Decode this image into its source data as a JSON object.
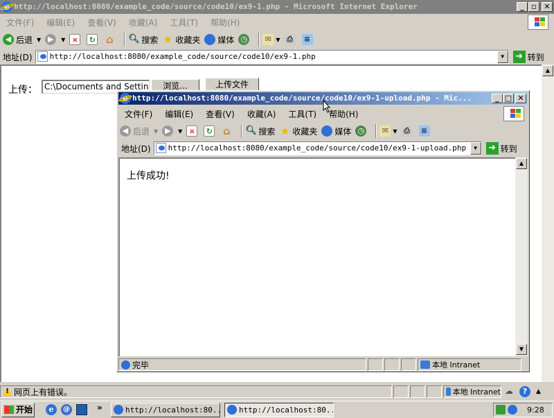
{
  "outer": {
    "title": "http://localhost:8080/example_code/source/code10/ex9-1.php - Microsoft Internet Explorer",
    "menu": [
      "文件(F)",
      "编辑(E)",
      "查看(V)",
      "收藏(A)",
      "工具(T)",
      "帮助(H)"
    ],
    "toolbar": {
      "back": "后退",
      "search": "搜索",
      "favorites": "收藏夹",
      "media": "媒体"
    },
    "address_label": "地址(D)",
    "address": "http://localhost:8080/example_code/source/code10/ex9-1.php",
    "go": "转到",
    "page": {
      "upload_label": "上传：",
      "file_value": "C:\\Documents and Settings",
      "browse": "浏览...",
      "submit": "上传文件"
    },
    "status_text": "网页上有错误。",
    "zone": "本地 Intranet"
  },
  "inner": {
    "title": "http://localhost:8080/example_code/source/code10/ex9-1-upload.php - Mic...",
    "menu": [
      "文件(F)",
      "编辑(E)",
      "查看(V)",
      "收藏(A)",
      "工具(T)",
      "帮助(H)"
    ],
    "toolbar": {
      "back": "后退",
      "search": "搜索",
      "favorites": "收藏夹",
      "media": "媒体"
    },
    "address_label": "地址(D)",
    "address": "http://localhost:8080/example_code/source/code10/ex9-1-upload.php",
    "go": "转到",
    "message": "上传成功!",
    "status_text": "完毕",
    "zone": "本地 Intranet"
  },
  "taskbar": {
    "start": "开始",
    "more": "»",
    "tasks": [
      "http://localhost:80...",
      "http://localhost:80..."
    ],
    "clock": "9:28"
  }
}
